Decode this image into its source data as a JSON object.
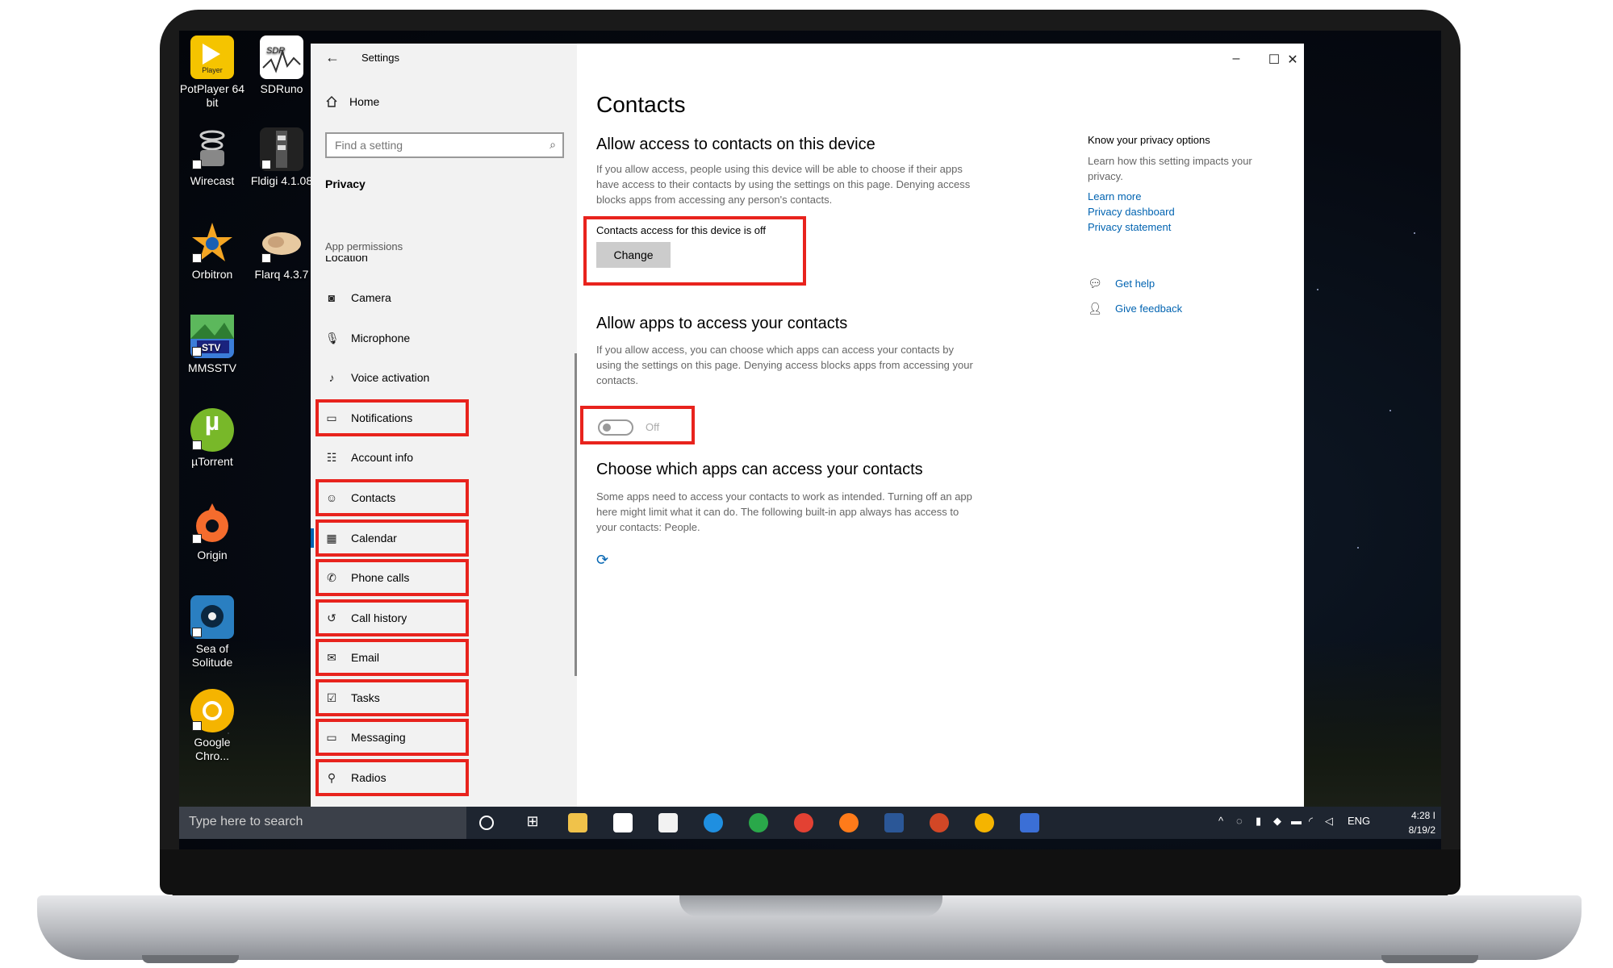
{
  "desktop": {
    "icons": [
      {
        "label_line1": "PotPlayer 64",
        "label_line2": "bit",
        "icon": "potplayer-icon",
        "badge": "Player"
      },
      {
        "label_line1": "SDRuno",
        "label_line2": "",
        "icon": "sdruno-icon"
      },
      {
        "label_line1": "Wirecast",
        "label_line2": "",
        "icon": "wirecast-icon"
      },
      {
        "label_line1": "Fldigi 4.1.08",
        "label_line2": "",
        "icon": "fldigi-icon"
      },
      {
        "label_line1": "Orbitron",
        "label_line2": "",
        "icon": "orbitron-icon"
      },
      {
        "label_line1": "Flarq 4.3.7",
        "label_line2": "",
        "icon": "flarq-icon"
      },
      {
        "label_line1": "MMSSTV",
        "label_line2": "",
        "icon": "mmsstv-icon"
      },
      {
        "label_line1": "µTorrent",
        "label_line2": "",
        "icon": "utorrent-icon"
      },
      {
        "label_line1": "Origin",
        "label_line2": "",
        "icon": "origin-icon"
      },
      {
        "label_line1": "Sea of",
        "label_line2": "Solitude",
        "icon": "sea-of-solitude-icon"
      },
      {
        "label_line1": "Google",
        "label_line2": "Chro...",
        "icon": "chrome-icon"
      }
    ]
  },
  "window": {
    "title": "Settings",
    "back_icon": "back-arrow-icon",
    "controls": {
      "minimize": "–",
      "maximize": "☐",
      "close": "✕"
    }
  },
  "sidebar": {
    "home_label": "Home",
    "search_placeholder": "Find a setting",
    "section_label": "Privacy",
    "group_label": "App permissions",
    "cut_item": "Location",
    "items": [
      {
        "label": "Camera",
        "icon": "camera-icon",
        "highlighted": false
      },
      {
        "label": "Microphone",
        "icon": "microphone-icon",
        "highlighted": false
      },
      {
        "label": "Voice activation",
        "icon": "voice-activation-icon",
        "highlighted": false
      },
      {
        "label": "Notifications",
        "icon": "notifications-icon",
        "highlighted": true
      },
      {
        "label": "Account info",
        "icon": "account-info-icon",
        "highlighted": false
      },
      {
        "label": "Contacts",
        "icon": "contacts-icon",
        "highlighted": true,
        "active": true
      },
      {
        "label": "Calendar",
        "icon": "calendar-icon",
        "highlighted": true
      },
      {
        "label": "Phone calls",
        "icon": "phone-icon",
        "highlighted": true
      },
      {
        "label": "Call history",
        "icon": "history-icon",
        "highlighted": true
      },
      {
        "label": "Email",
        "icon": "email-icon",
        "highlighted": true
      },
      {
        "label": "Tasks",
        "icon": "tasks-icon",
        "highlighted": true
      },
      {
        "label": "Messaging",
        "icon": "messaging-icon",
        "highlighted": true
      },
      {
        "label": "Radios",
        "icon": "radios-icon",
        "highlighted": true
      }
    ]
  },
  "content": {
    "page_title": "Contacts",
    "section1": {
      "title": "Allow access to contacts on this device",
      "description": "If you allow access, people using this device will be able to choose if their apps have access to their contacts by using the settings on this page. Denying access blocks apps from accessing any person's contacts.",
      "status": "Contacts access for this device is off",
      "button": "Change"
    },
    "section2": {
      "title": "Allow apps to access your contacts",
      "description": "If you allow access, you can choose which apps can access your contacts by using the settings on this page. Denying access blocks apps from accessing your contacts.",
      "toggle_state": "Off"
    },
    "section3": {
      "title": "Choose which apps can access your contacts",
      "description": "Some apps need to access your contacts to work as intended. Turning off an app here might limit what it can do. The following built-in app always has access to your contacts: People."
    },
    "right_panel": {
      "title": "Know your privacy options",
      "description": "Learn how this setting impacts your privacy.",
      "links": [
        "Learn more",
        "Privacy dashboard",
        "Privacy statement"
      ],
      "get_help": "Get help",
      "give_feedback": "Give feedback"
    }
  },
  "taskbar": {
    "search_placeholder": "Type here to search",
    "language": "ENG",
    "time": "4:28 I",
    "date": "8/19/2"
  },
  "colors": {
    "accent": "#0063b1",
    "highlight_box": "#e8231d",
    "taskbar": "#1e2530"
  }
}
